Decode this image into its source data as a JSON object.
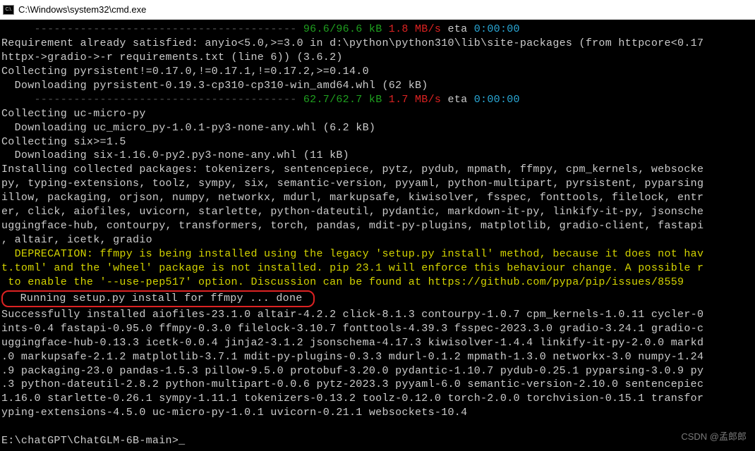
{
  "titlebar": {
    "icon_label": "C:\\.",
    "title": "C:\\Windows\\system32\\cmd.exe"
  },
  "progress1": {
    "dashes": "     ---------------------------------------- ",
    "done": "96.6/96.6 kB",
    "speed": " 1.8 MB/s",
    "eta_label": " eta ",
    "eta": "0:00:00"
  },
  "req_satisfied": "Requirement already satisfied: anyio<5.0,>=3.0 in d:\\python\\python310\\lib\\site-packages (from httpcore<0.17\nhttpx->gradio->-r requirements.txt (line 6)) (3.6.2)",
  "collecting_pyr": "Collecting pyrsistent!=0.17.0,!=0.17.1,!=0.17.2,>=0.14.0",
  "download_pyr": "  Downloading pyrsistent-0.19.3-cp310-cp310-win_amd64.whl (62 kB)",
  "progress2": {
    "dashes": "     ---------------------------------------- ",
    "done": "62.7/62.7 kB",
    "speed": " 1.7 MB/s",
    "eta_label": " eta ",
    "eta": "0:00:00"
  },
  "collecting_uc": "Collecting uc-micro-py",
  "download_uc": "  Downloading uc_micro_py-1.0.1-py3-none-any.whl (6.2 kB)",
  "collecting_six": "Collecting six>=1.5",
  "download_six": "  Downloading six-1.16.0-py2.py3-none-any.whl (11 kB)",
  "install_packages": "Installing collected packages: tokenizers, sentencepiece, pytz, pydub, mpmath, ffmpy, cpm_kernels, websocke\npy, typing-extensions, toolz, sympy, six, semantic-version, pyyaml, python-multipart, pyrsistent, pyparsing\nillow, packaging, orjson, numpy, networkx, mdurl, markupsafe, kiwisolver, fsspec, fonttools, filelock, entr\ner, click, aiofiles, uvicorn, starlette, python-dateutil, pydantic, markdown-it-py, linkify-it-py, jsonsche\nuggingface-hub, contourpy, transformers, torch, pandas, mdit-py-plugins, matplotlib, gradio-client, fastapi\n, altair, icetk, gradio",
  "deprecation": "  DEPRECATION: ffmpy is being installed using the legacy 'setup.py install' method, because it does not hav\nt.toml' and the 'wheel' package is not installed. pip 23.1 will enforce this behaviour change. A possible r\n to enable the '--use-pep517' option. Discussion can be found at https://github.com/pypa/pip/issues/8559",
  "running_setup": "  Running setup.py install for ffmpy ... done ",
  "success": "Successfully installed aiofiles-23.1.0 altair-4.2.2 click-8.1.3 contourpy-1.0.7 cpm_kernels-1.0.11 cycler-0\nints-0.4 fastapi-0.95.0 ffmpy-0.3.0 filelock-3.10.7 fonttools-4.39.3 fsspec-2023.3.0 gradio-3.24.1 gradio-c\nuggingface-hub-0.13.3 icetk-0.0.4 jinja2-3.1.2 jsonschema-4.17.3 kiwisolver-1.4.4 linkify-it-py-2.0.0 markd\n.0 markupsafe-2.1.2 matplotlib-3.7.1 mdit-py-plugins-0.3.3 mdurl-0.1.2 mpmath-1.3.0 networkx-3.0 numpy-1.24\n.9 packaging-23.0 pandas-1.5.3 pillow-9.5.0 protobuf-3.20.0 pydantic-1.10.7 pydub-0.25.1 pyparsing-3.0.9 py\n.3 python-dateutil-2.8.2 python-multipart-0.0.6 pytz-2023.3 pyyaml-6.0 semantic-version-2.10.0 sentencepiec\n1.16.0 starlette-0.26.1 sympy-1.11.1 tokenizers-0.13.2 toolz-0.12.0 torch-2.0.0 torchvision-0.15.1 transfor\nyping-extensions-4.5.0 uc-micro-py-1.0.1 uvicorn-0.21.1 websockets-10.4",
  "prompt": "E:\\chatGPT\\ChatGLM-6B-main>",
  "cursor": "_",
  "watermark": "CSDN @孟郎郎"
}
